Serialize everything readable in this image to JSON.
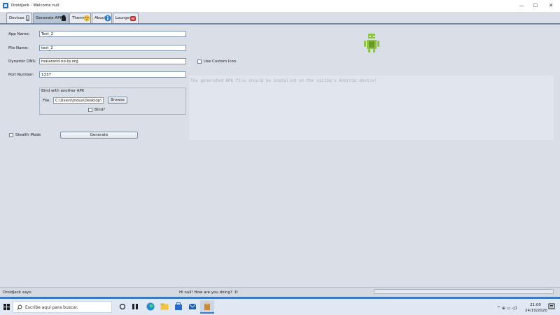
{
  "window": {
    "title": "DroidJack - Welcome null",
    "minimize": "—",
    "maximize": "☐",
    "close": "✕"
  },
  "tabs": [
    {
      "label": "Devices"
    },
    {
      "label": "Generate APK"
    },
    {
      "label": "Theme"
    },
    {
      "label": "About"
    },
    {
      "label": "Lounge"
    }
  ],
  "form": {
    "app_name_label": "App Name:",
    "app_name_value": "Test_2",
    "file_name_label": "File Name:",
    "file_name_value": "test_2",
    "dns_label": "Dynamic DNS:",
    "dns_value": "maiarand.no-ip.org",
    "port_label": "Port Number:",
    "port_value": "1337",
    "use_custom_icon_label": "Use Custom Icon",
    "bind_title": "Bind with another APK",
    "bind_file_label": "File:",
    "bind_file_value": "C:\\Users\\Indus\\Desktop\\com",
    "browse_label": "Browse",
    "bind_label": "Bind?",
    "stealth_label": "Stealth Mode",
    "generate_label": "Generate"
  },
  "console_text": "The generated APK file should be installed on the victim's Android device!",
  "status": {
    "left": "DroidJack says:",
    "message": "Hi null! How are you doing? :D"
  },
  "taskbar": {
    "search_placeholder": "Escribe aquí para buscar.",
    "time": "21:00",
    "date": "24/10/2020",
    "tray_symbols": "^ ⊕ ▭ ◁)"
  },
  "colors": {
    "accent_blue": "#3a78c2",
    "android_green": "#8cc63f"
  }
}
